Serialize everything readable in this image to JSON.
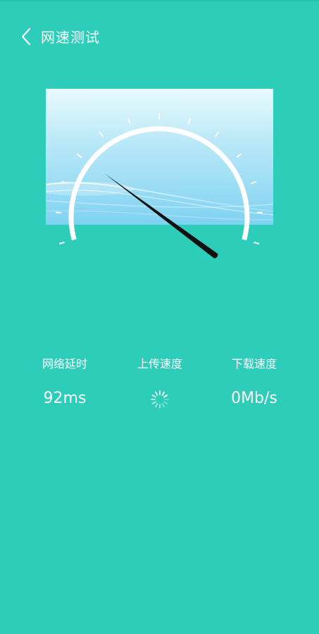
{
  "header": {
    "title": "网速测试",
    "back_icon": "chevron-left-icon"
  },
  "gauge": {
    "needle_value_fraction": 0.32
  },
  "stats": {
    "latency": {
      "label": "网络延时",
      "value": "92ms"
    },
    "upload": {
      "label": "上传速度",
      "status_icon": "loading-spinner-icon"
    },
    "download": {
      "label": "下载速度",
      "value": "0Mb/s"
    }
  },
  "colors": {
    "background": "#2ecdb9",
    "text": "#ffffff",
    "needle": "#111111"
  }
}
